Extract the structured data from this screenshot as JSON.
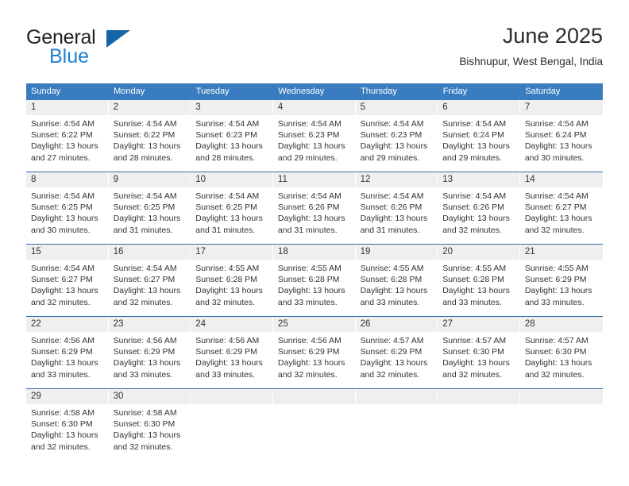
{
  "brand": {
    "name_top": "General",
    "name_bottom": "Blue",
    "triangle_color": "#1565a8",
    "blue_color": "#1f7fd0"
  },
  "header": {
    "title": "June 2025",
    "subtitle": "Bishnupur, West Bengal, India"
  },
  "theme": {
    "header_bg": "#3a7cc0",
    "daynum_bg": "#efefef",
    "row_divider": "#2f6ea8",
    "text": "#333333"
  },
  "weekdays": [
    "Sunday",
    "Monday",
    "Tuesday",
    "Wednesday",
    "Thursday",
    "Friday",
    "Saturday"
  ],
  "weeks": [
    [
      {
        "day": "1",
        "sunrise": "Sunrise: 4:54 AM",
        "sunset": "Sunset: 6:22 PM",
        "daylight1": "Daylight: 13 hours",
        "daylight2": "and 27 minutes."
      },
      {
        "day": "2",
        "sunrise": "Sunrise: 4:54 AM",
        "sunset": "Sunset: 6:22 PM",
        "daylight1": "Daylight: 13 hours",
        "daylight2": "and 28 minutes."
      },
      {
        "day": "3",
        "sunrise": "Sunrise: 4:54 AM",
        "sunset": "Sunset: 6:23 PM",
        "daylight1": "Daylight: 13 hours",
        "daylight2": "and 28 minutes."
      },
      {
        "day": "4",
        "sunrise": "Sunrise: 4:54 AM",
        "sunset": "Sunset: 6:23 PM",
        "daylight1": "Daylight: 13 hours",
        "daylight2": "and 29 minutes."
      },
      {
        "day": "5",
        "sunrise": "Sunrise: 4:54 AM",
        "sunset": "Sunset: 6:23 PM",
        "daylight1": "Daylight: 13 hours",
        "daylight2": "and 29 minutes."
      },
      {
        "day": "6",
        "sunrise": "Sunrise: 4:54 AM",
        "sunset": "Sunset: 6:24 PM",
        "daylight1": "Daylight: 13 hours",
        "daylight2": "and 29 minutes."
      },
      {
        "day": "7",
        "sunrise": "Sunrise: 4:54 AM",
        "sunset": "Sunset: 6:24 PM",
        "daylight1": "Daylight: 13 hours",
        "daylight2": "and 30 minutes."
      }
    ],
    [
      {
        "day": "8",
        "sunrise": "Sunrise: 4:54 AM",
        "sunset": "Sunset: 6:25 PM",
        "daylight1": "Daylight: 13 hours",
        "daylight2": "and 30 minutes."
      },
      {
        "day": "9",
        "sunrise": "Sunrise: 4:54 AM",
        "sunset": "Sunset: 6:25 PM",
        "daylight1": "Daylight: 13 hours",
        "daylight2": "and 31 minutes."
      },
      {
        "day": "10",
        "sunrise": "Sunrise: 4:54 AM",
        "sunset": "Sunset: 6:25 PM",
        "daylight1": "Daylight: 13 hours",
        "daylight2": "and 31 minutes."
      },
      {
        "day": "11",
        "sunrise": "Sunrise: 4:54 AM",
        "sunset": "Sunset: 6:26 PM",
        "daylight1": "Daylight: 13 hours",
        "daylight2": "and 31 minutes."
      },
      {
        "day": "12",
        "sunrise": "Sunrise: 4:54 AM",
        "sunset": "Sunset: 6:26 PM",
        "daylight1": "Daylight: 13 hours",
        "daylight2": "and 31 minutes."
      },
      {
        "day": "13",
        "sunrise": "Sunrise: 4:54 AM",
        "sunset": "Sunset: 6:26 PM",
        "daylight1": "Daylight: 13 hours",
        "daylight2": "and 32 minutes."
      },
      {
        "day": "14",
        "sunrise": "Sunrise: 4:54 AM",
        "sunset": "Sunset: 6:27 PM",
        "daylight1": "Daylight: 13 hours",
        "daylight2": "and 32 minutes."
      }
    ],
    [
      {
        "day": "15",
        "sunrise": "Sunrise: 4:54 AM",
        "sunset": "Sunset: 6:27 PM",
        "daylight1": "Daylight: 13 hours",
        "daylight2": "and 32 minutes."
      },
      {
        "day": "16",
        "sunrise": "Sunrise: 4:54 AM",
        "sunset": "Sunset: 6:27 PM",
        "daylight1": "Daylight: 13 hours",
        "daylight2": "and 32 minutes."
      },
      {
        "day": "17",
        "sunrise": "Sunrise: 4:55 AM",
        "sunset": "Sunset: 6:28 PM",
        "daylight1": "Daylight: 13 hours",
        "daylight2": "and 32 minutes."
      },
      {
        "day": "18",
        "sunrise": "Sunrise: 4:55 AM",
        "sunset": "Sunset: 6:28 PM",
        "daylight1": "Daylight: 13 hours",
        "daylight2": "and 33 minutes."
      },
      {
        "day": "19",
        "sunrise": "Sunrise: 4:55 AM",
        "sunset": "Sunset: 6:28 PM",
        "daylight1": "Daylight: 13 hours",
        "daylight2": "and 33 minutes."
      },
      {
        "day": "20",
        "sunrise": "Sunrise: 4:55 AM",
        "sunset": "Sunset: 6:28 PM",
        "daylight1": "Daylight: 13 hours",
        "daylight2": "and 33 minutes."
      },
      {
        "day": "21",
        "sunrise": "Sunrise: 4:55 AM",
        "sunset": "Sunset: 6:29 PM",
        "daylight1": "Daylight: 13 hours",
        "daylight2": "and 33 minutes."
      }
    ],
    [
      {
        "day": "22",
        "sunrise": "Sunrise: 4:56 AM",
        "sunset": "Sunset: 6:29 PM",
        "daylight1": "Daylight: 13 hours",
        "daylight2": "and 33 minutes."
      },
      {
        "day": "23",
        "sunrise": "Sunrise: 4:56 AM",
        "sunset": "Sunset: 6:29 PM",
        "daylight1": "Daylight: 13 hours",
        "daylight2": "and 33 minutes."
      },
      {
        "day": "24",
        "sunrise": "Sunrise: 4:56 AM",
        "sunset": "Sunset: 6:29 PM",
        "daylight1": "Daylight: 13 hours",
        "daylight2": "and 33 minutes."
      },
      {
        "day": "25",
        "sunrise": "Sunrise: 4:56 AM",
        "sunset": "Sunset: 6:29 PM",
        "daylight1": "Daylight: 13 hours",
        "daylight2": "and 32 minutes."
      },
      {
        "day": "26",
        "sunrise": "Sunrise: 4:57 AM",
        "sunset": "Sunset: 6:29 PM",
        "daylight1": "Daylight: 13 hours",
        "daylight2": "and 32 minutes."
      },
      {
        "day": "27",
        "sunrise": "Sunrise: 4:57 AM",
        "sunset": "Sunset: 6:30 PM",
        "daylight1": "Daylight: 13 hours",
        "daylight2": "and 32 minutes."
      },
      {
        "day": "28",
        "sunrise": "Sunrise: 4:57 AM",
        "sunset": "Sunset: 6:30 PM",
        "daylight1": "Daylight: 13 hours",
        "daylight2": "and 32 minutes."
      }
    ],
    [
      {
        "day": "29",
        "sunrise": "Sunrise: 4:58 AM",
        "sunset": "Sunset: 6:30 PM",
        "daylight1": "Daylight: 13 hours",
        "daylight2": "and 32 minutes."
      },
      {
        "day": "30",
        "sunrise": "Sunrise: 4:58 AM",
        "sunset": "Sunset: 6:30 PM",
        "daylight1": "Daylight: 13 hours",
        "daylight2": "and 32 minutes."
      },
      {
        "day": "",
        "sunrise": "",
        "sunset": "",
        "daylight1": "",
        "daylight2": ""
      },
      {
        "day": "",
        "sunrise": "",
        "sunset": "",
        "daylight1": "",
        "daylight2": ""
      },
      {
        "day": "",
        "sunrise": "",
        "sunset": "",
        "daylight1": "",
        "daylight2": ""
      },
      {
        "day": "",
        "sunrise": "",
        "sunset": "",
        "daylight1": "",
        "daylight2": ""
      },
      {
        "day": "",
        "sunrise": "",
        "sunset": "",
        "daylight1": "",
        "daylight2": ""
      }
    ]
  ]
}
